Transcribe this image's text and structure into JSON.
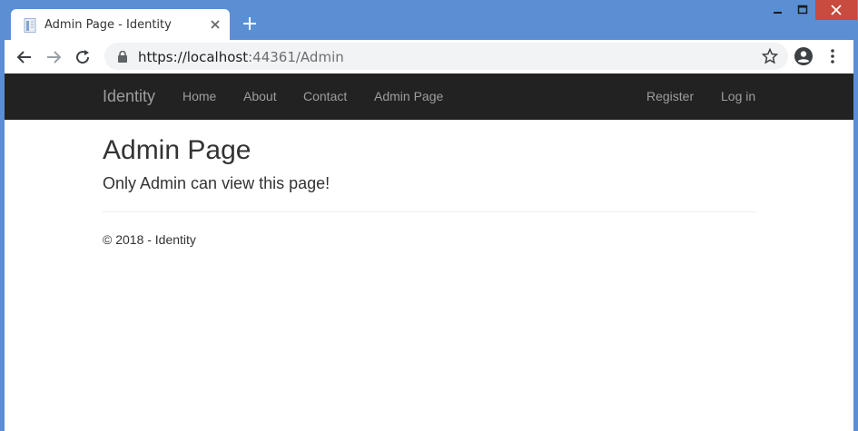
{
  "browser": {
    "tab": {
      "title": "Admin Page - Identity",
      "favicon": "document-icon",
      "close_icon": "close-icon"
    },
    "new_tab_icon": "plus-icon",
    "window_controls": [
      "minimize-icon",
      "maximize-icon",
      "close-icon"
    ],
    "toolbar": {
      "back_icon": "arrow-left-icon",
      "forward_icon": "arrow-right-icon",
      "reload_icon": "reload-icon",
      "address": {
        "lock_icon": "lock-icon",
        "host": "https://localhost",
        "rest": ":44361/Admin"
      },
      "bookmark_icon": "star-icon",
      "account_icon": "account-icon",
      "menu_icon": "more-vertical-icon"
    },
    "colors": {
      "frame": "#5b8fd4",
      "close_button": "#c94a3f"
    }
  },
  "site": {
    "navbar": {
      "brand": "Identity",
      "links": [
        "Home",
        "About",
        "Contact",
        "Admin Page"
      ],
      "right_links": [
        "Register",
        "Log in"
      ],
      "background": "#222222",
      "link_color": "#9d9d9d"
    },
    "main": {
      "heading": "Admin Page",
      "text": "Only Admin can view this page!"
    },
    "footer": {
      "text": "© 2018 - Identity"
    }
  }
}
